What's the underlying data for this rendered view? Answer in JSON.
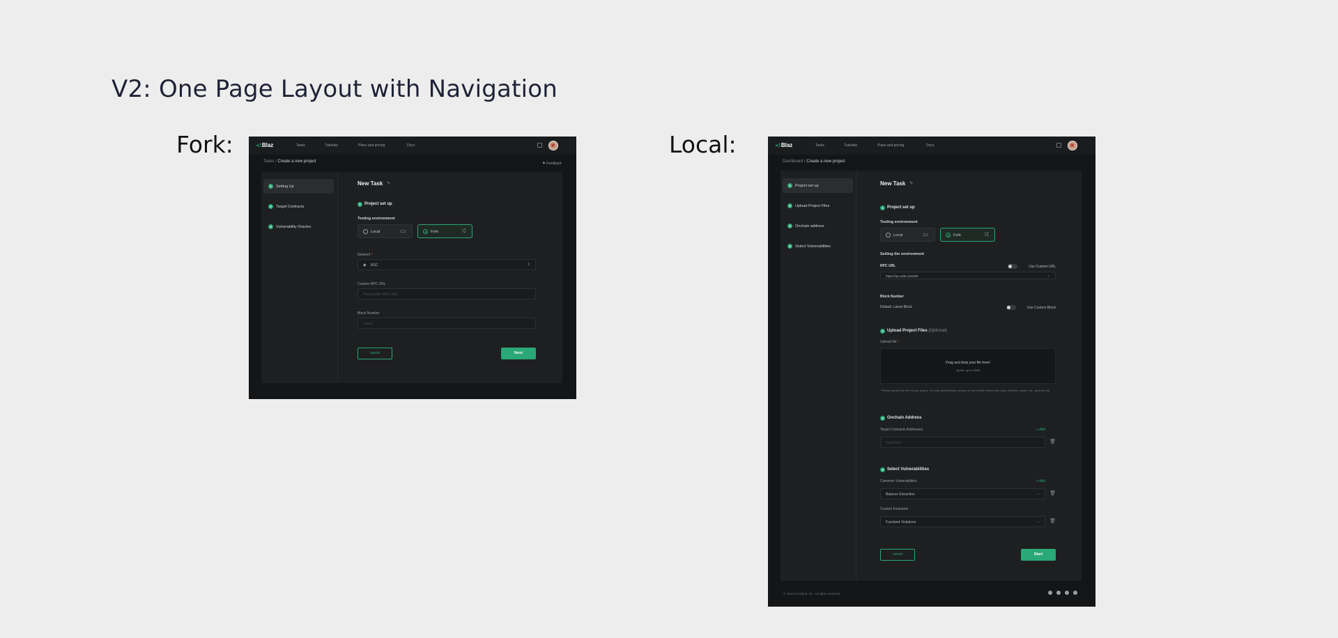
{
  "canvas": {
    "title": "V2: One Page Layout with Navigation",
    "fork_label": "Fork:",
    "local_label": "Local:"
  },
  "colors": {
    "accent": "#2aa876",
    "frame_bg": "#141516",
    "panel_bg": "#1e1f21"
  },
  "fork": {
    "logo": "Blaz",
    "nav": [
      "Tasks",
      "Tutorials",
      "Plans and pricing",
      "Docs"
    ],
    "breadcrumb": {
      "parent": "Tasks",
      "sep": " / ",
      "current": "Create a new project"
    },
    "feedback": "Feedback",
    "sidebar": [
      {
        "num": "1",
        "label": "Setting Up"
      },
      {
        "num": "2",
        "label": "Target Contracts"
      },
      {
        "num": "3",
        "label": "Vulnerability Oracles"
      }
    ],
    "task_title": "New Task",
    "section1": {
      "num": "1",
      "title": "Project set up"
    },
    "testing_env_label": "Testing environment",
    "env_options": [
      {
        "label": "Local",
        "icon": "monitor-icon"
      },
      {
        "label": "Fork",
        "icon": "fork-icon"
      }
    ],
    "network": {
      "label": "Network",
      "req": " *",
      "value": "BSC"
    },
    "custom_rpc": {
      "label": "Custom RPC URL",
      "placeholder": "Placeholder RPC URL"
    },
    "block_number": {
      "label": "Block Number",
      "placeholder": "Latest"
    },
    "cancel": "cancel",
    "next": "Next"
  },
  "local": {
    "logo": "Blaz",
    "nav": [
      "Tasks",
      "Tutorials",
      "Plans and pricing",
      "Docs"
    ],
    "breadcrumb": {
      "parent": "Dashboard",
      "sep": " / ",
      "current": "Create a new project"
    },
    "sidebar": [
      {
        "num": "1",
        "label": "Project set up"
      },
      {
        "num": "2",
        "label": "Upload Project Files"
      },
      {
        "num": "3",
        "label": "Onchain address"
      },
      {
        "num": "4",
        "label": "Select Vulnerabilities"
      }
    ],
    "task_title": "New Task",
    "section1": {
      "num": "1",
      "title": "Project set up"
    },
    "testing_env_label": "Testing environment",
    "env_options": [
      {
        "label": "Local",
        "icon": "monitor-icon"
      },
      {
        "label": "Fork",
        "icon": "fork-icon"
      }
    ],
    "setting_env": "Setting the environment",
    "rpc": {
      "label": "RPC URL",
      "toggle_label": "Use Custom URL",
      "value": "https://rpc.ankr.com/eth"
    },
    "block": {
      "label": "Block Number",
      "default": "Default: Latest Block",
      "toggle_label": "Use Custom Block"
    },
    "section2": {
      "num": "2",
      "title": "Upload Project Files",
      "optional": "(Optional)"
    },
    "upload": {
      "label": "Upload file",
      "req": " *",
      "drop_main": "Drag and drop your file here!",
      "drop_sub": "zip file, up to 10MB",
      "note": "* Please upload Zip File of your project. To make upload faster, please do not include folders like node_modules, cache, out, .git in the zip."
    },
    "section3": {
      "num": "3",
      "title": "Onchain Address"
    },
    "target": {
      "label": "Target Contracts Addresses",
      "add": "+ Add",
      "placeholder": "Input here"
    },
    "section4": {
      "num": "4",
      "title": "Select Vulnerabilities"
    },
    "common_vuln": {
      "label": "Common Vulnerabilities",
      "add": "+ Add",
      "value": "Balance Extraction"
    },
    "custom_inv": {
      "label": "Custom Invariants",
      "value": "Fuzzland Violations"
    },
    "cancel": "cancel",
    "start": "Start",
    "footer": "© 2023 Fuzzland, Inc. All rights reserved."
  }
}
